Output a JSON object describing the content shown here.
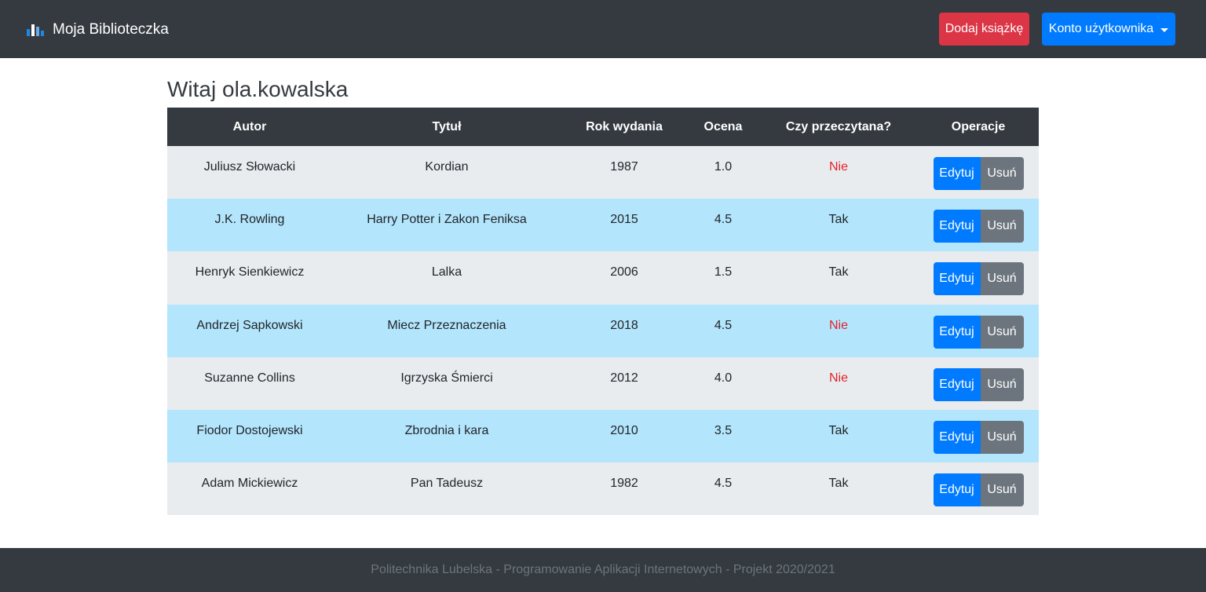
{
  "navbar": {
    "brand": "Moja Biblioteczka",
    "brand_icon": "bar-chart-icon",
    "add_book_label": "Dodaj książkę",
    "account_label": "Konto użytkownika",
    "colors": {
      "background": "#343a40",
      "add_button": "#dc3545",
      "account_button": "#007bff"
    }
  },
  "main": {
    "greeting": "Witaj ola.kowalska"
  },
  "table": {
    "headers": [
      "Autor",
      "Tytuł",
      "Rok wydania",
      "Ocena",
      "Czy przeczytana?",
      "Operacje"
    ],
    "rows": [
      {
        "author": "Juliusz Słowacki",
        "title": "Kordian",
        "year": "1987",
        "rating": "1.0",
        "read": "Nie"
      },
      {
        "author": "J.K. Rowling",
        "title": "Harry Potter i Zakon Feniksa",
        "year": "2015",
        "rating": "4.5",
        "read": "Tak"
      },
      {
        "author": "Henryk Sienkiewicz",
        "title": "Lalka",
        "year": "2006",
        "rating": "1.5",
        "read": "Tak"
      },
      {
        "author": "Andrzej Sapkowski",
        "title": "Miecz Przeznaczenia",
        "year": "2018",
        "rating": "4.5",
        "read": "Nie"
      },
      {
        "author": "Suzanne Collins",
        "title": "Igrzyska Śmierci",
        "year": "2012",
        "rating": "4.0",
        "read": "Nie"
      },
      {
        "author": "Fiodor Dostojewski",
        "title": "Zbrodnia i kara",
        "year": "2010",
        "rating": "3.5",
        "read": "Tak"
      },
      {
        "author": "Adam Mickiewicz",
        "title": "Pan Tadeusz",
        "year": "1982",
        "rating": "4.5",
        "read": "Tak"
      }
    ],
    "edit_label": "Edytuj",
    "delete_label": "Usuń",
    "colors": {
      "header": "#343a40",
      "row_light": "#e9ecef",
      "row_blue": "#b3e5fc",
      "unread": "#e3242b",
      "edit_button": "#007bff",
      "delete_button": "#6c757d"
    }
  },
  "footer": {
    "text": "Politechnika Lubelska - Programowanie Aplikacji Internetowych - Projekt 2020/2021"
  }
}
